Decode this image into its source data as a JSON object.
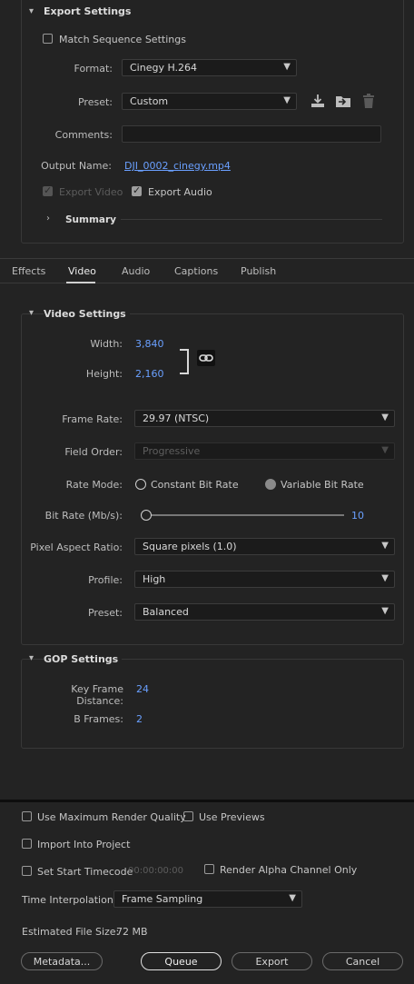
{
  "export_settings": {
    "title": "Export Settings",
    "match_sequence": {
      "label": "Match Sequence Settings",
      "checked": false
    },
    "format": {
      "label": "Format:",
      "value": "Cinegy H.264"
    },
    "preset": {
      "label": "Preset:",
      "value": "Custom"
    },
    "comments": {
      "label": "Comments:",
      "value": ""
    },
    "output_name": {
      "label": "Output Name:",
      "value": "DJI_0002_cinegy.mp4"
    },
    "export_video": {
      "label": "Export Video",
      "checked": true,
      "disabled": true
    },
    "export_audio": {
      "label": "Export Audio",
      "checked": true
    },
    "summary": {
      "label": "Summary"
    }
  },
  "tabs": [
    {
      "label": "Effects",
      "active": false
    },
    {
      "label": "Video",
      "active": true
    },
    {
      "label": "Audio",
      "active": false
    },
    {
      "label": "Captions",
      "active": false
    },
    {
      "label": "Publish",
      "active": false
    }
  ],
  "video_settings": {
    "title": "Video Settings",
    "width": {
      "label": "Width:",
      "value": "3,840"
    },
    "height": {
      "label": "Height:",
      "value": "2,160"
    },
    "frame_rate": {
      "label": "Frame Rate:",
      "value": "29.97 (NTSC)"
    },
    "field_order": {
      "label": "Field Order:",
      "value": "Progressive"
    },
    "rate_mode": {
      "label": "Rate Mode:",
      "option1": "Constant Bit Rate",
      "option2": "Variable Bit Rate",
      "selected": "Variable Bit Rate"
    },
    "bit_rate": {
      "label": "Bit Rate (Mb/s):",
      "value": "10"
    },
    "pixel_aspect": {
      "label": "Pixel Aspect Ratio:",
      "value": "Square pixels (1.0)"
    },
    "profile": {
      "label": "Profile:",
      "value": "High"
    },
    "preset": {
      "label": "Preset:",
      "value": "Balanced"
    }
  },
  "gop_settings": {
    "title": "GOP Settings",
    "key_frame_distance": {
      "label": "Key Frame Distance:",
      "value": "24"
    },
    "b_frames": {
      "label": "B Frames:",
      "value": "2"
    }
  },
  "bottom": {
    "max_render_quality": {
      "label": "Use Maximum Render Quality",
      "checked": false
    },
    "use_previews": {
      "label": "Use Previews",
      "checked": false
    },
    "import_into_project": {
      "label": "Import Into Project",
      "checked": false
    },
    "set_start_timecode": {
      "label": "Set Start Timecode",
      "checked": false,
      "timecode": "00:00:00:00"
    },
    "render_alpha": {
      "label": "Render Alpha Channel Only",
      "checked": false
    },
    "time_interpolation": {
      "label": "Time Interpolation:",
      "value": "Frame Sampling"
    },
    "estimated_file_size": {
      "label": "Estimated File Size:",
      "value": "72 MB"
    }
  },
  "buttons": {
    "metadata": "Metadata...",
    "queue": "Queue",
    "export": "Export",
    "cancel": "Cancel"
  },
  "colors": {
    "accent": "#6aa0ff",
    "background": "#232323"
  },
  "icons": [
    "chevron-down-icon",
    "chevron-right-icon",
    "save-preset-icon",
    "import-preset-icon",
    "delete-preset-icon",
    "link-icon"
  ]
}
